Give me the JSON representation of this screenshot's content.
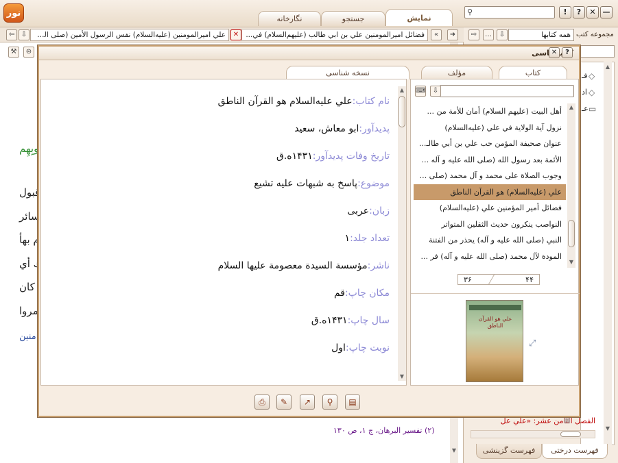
{
  "window": {
    "logo_text": "نور",
    "tabs": [
      {
        "label": "نمایش",
        "active": true
      },
      {
        "label": "جستجو",
        "active": false
      },
      {
        "label": "نگارخانه",
        "active": false
      }
    ],
    "controls": {
      "close": "✕",
      "help": "?",
      "info": "!"
    }
  },
  "right_panel": {
    "collection_label": "مجموعه كتب",
    "collection_value": "همه كتابها",
    "tree_fragments": [
      "فـ",
      "اد",
      "عـ"
    ],
    "bottom_item": "الفصل الثامن عشر: «علي عل",
    "bottom_tabs": [
      {
        "label": "فهرست درختی",
        "active": true
      },
      {
        "label": "فهرست گزینشی",
        "active": false
      }
    ]
  },
  "doc_tabs": [
    {
      "label": "فضائل اميرالمومنين علي بن ابي طالب (عليهم‌السلام) في..."
    },
    {
      "label": "علي اميرالمومنين (عليه‌السلام) نفس الرسول الأمين (صلى الل..."
    }
  ],
  "background_text": {
    "green_fragment": "لُوبِهِم",
    "lines": [
      "قبول",
      "سائر",
      "م بهأ",
      "ك أي",
      "ز كان",
      "مروا"
    ],
    "link_fragment": "منين»",
    "footnote": "(۲) تفسیر البرهان، ج ۱، ص ۱۳۰"
  },
  "dialog": {
    "title": "كتابشناسی",
    "left_tabs": [
      {
        "label": "كتاب",
        "active": true
      },
      {
        "label": "مؤلف",
        "active": false
      }
    ],
    "right_tab": "نسخه شناسی",
    "books": [
      {
        "title": "أهل البيت (عليهم السلام) أمان للأمة من ...",
        "selected": false
      },
      {
        "title": "نزول آية الولاية في علي (عليه‌السلام)",
        "selected": false
      },
      {
        "title": "عنوان صحيفة المؤمن حب علي بن أبي طالـ...",
        "selected": false
      },
      {
        "title": "الأئمة بعد رسول الله (صلى الله عليه و آله ...",
        "selected": false
      },
      {
        "title": "وجوب الصلاة على محمد و آل محمد (صلى ...",
        "selected": false
      },
      {
        "title": "علي (عليه‌السلام) هو القرآن الناطق",
        "selected": true
      },
      {
        "title": "فضائل أمير المؤمنين علي (عليه‌السلام)",
        "selected": false
      },
      {
        "title": "النواصب ينكرون حديث الثقلين المتواتر",
        "selected": false
      },
      {
        "title": "النبي (صلى الله عليه و آله) يحذر من الفتنة",
        "selected": false
      },
      {
        "title": "المودة لآل محمد (صلى الله عليه و آله) فر ...",
        "selected": false
      }
    ],
    "pager": {
      "current": "۳۶",
      "total": "۴۴"
    },
    "cover_title": "علي هو القرآن الناطق",
    "details": [
      {
        "label": "نام كتاب:",
        "value": "علي عليه‌السلام هو القرآن الناطق"
      },
      {
        "label": "پديدآور:",
        "value": "ابو معاش، سعيد"
      },
      {
        "label": "تاريخ وفات پديدآور:",
        "value": "۱۴۳۱ه.ق"
      },
      {
        "label": "موضوع:",
        "value": "پاسخ به شبهات عليه تشيع"
      },
      {
        "label": "زبان:",
        "value": "عربی"
      },
      {
        "label": "تعداد جلد:",
        "value": "۱"
      },
      {
        "label": "ناشر:",
        "value": "مؤسسة السيدة معصومة عليها السلام"
      },
      {
        "label": "مكان چاپ:",
        "value": "قم"
      },
      {
        "label": "سال چاپ:",
        "value": "۱۴۳۱ه.ق"
      },
      {
        "label": "نوبت چاپ:",
        "value": "اول"
      }
    ]
  }
}
